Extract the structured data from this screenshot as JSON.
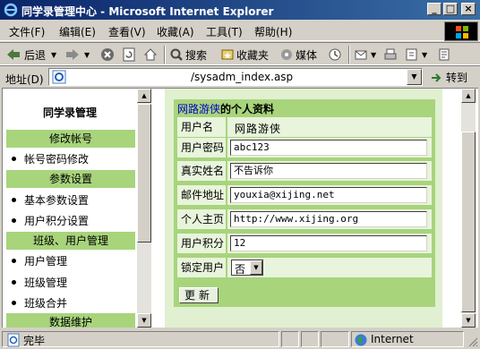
{
  "window": {
    "title": "同学录管理中心 - Microsoft Internet Explorer",
    "minimize": "_",
    "maximize": "□",
    "close": "×"
  },
  "menu": [
    "文件(F)",
    "编辑(E)",
    "查看(V)",
    "收藏(A)",
    "工具(T)",
    "帮助(H)"
  ],
  "toolbar": {
    "back": "后退",
    "search": "搜索",
    "favorites": "收藏夹",
    "media": "媒体"
  },
  "address": {
    "label": "地址(D)",
    "url": "/sysadm_index.asp",
    "go": "转到"
  },
  "sidebar": {
    "title": "同学录管理",
    "sections": [
      {
        "header": "修改帐号",
        "links": [
          "帐号密码修改"
        ]
      },
      {
        "header": "参数设置",
        "links": [
          "基本参数设置",
          "用户积分设置"
        ]
      },
      {
        "header": "班级、用户管理",
        "links": [
          "用户管理",
          "班级管理",
          "班级合并"
        ]
      },
      {
        "header": "数据维护",
        "links": []
      }
    ]
  },
  "profile": {
    "heading_name": "网路游侠",
    "heading_suffix": "的个人资料",
    "rows": [
      {
        "label": "用户名",
        "value": "网路游侠",
        "type": "text"
      },
      {
        "label": "用户密码",
        "value": "abc123",
        "type": "input"
      },
      {
        "label": "真实姓名",
        "value": "不告诉你",
        "type": "input"
      },
      {
        "label": "邮件地址",
        "value": "youxia@xijing.net",
        "type": "input"
      },
      {
        "label": "个人主页",
        "value": "http://www.xijing.org",
        "type": "input"
      },
      {
        "label": "用户积分",
        "value": "12",
        "type": "input"
      },
      {
        "label": "锁定用户",
        "value": "否",
        "type": "select"
      }
    ],
    "submit": "更新"
  },
  "status": {
    "text": "完毕",
    "zone": "Internet"
  },
  "colors": {
    "panel_green": "#a8d47c",
    "row_bg": "#e8f4dc",
    "highlight_blue": "#0000cc"
  }
}
